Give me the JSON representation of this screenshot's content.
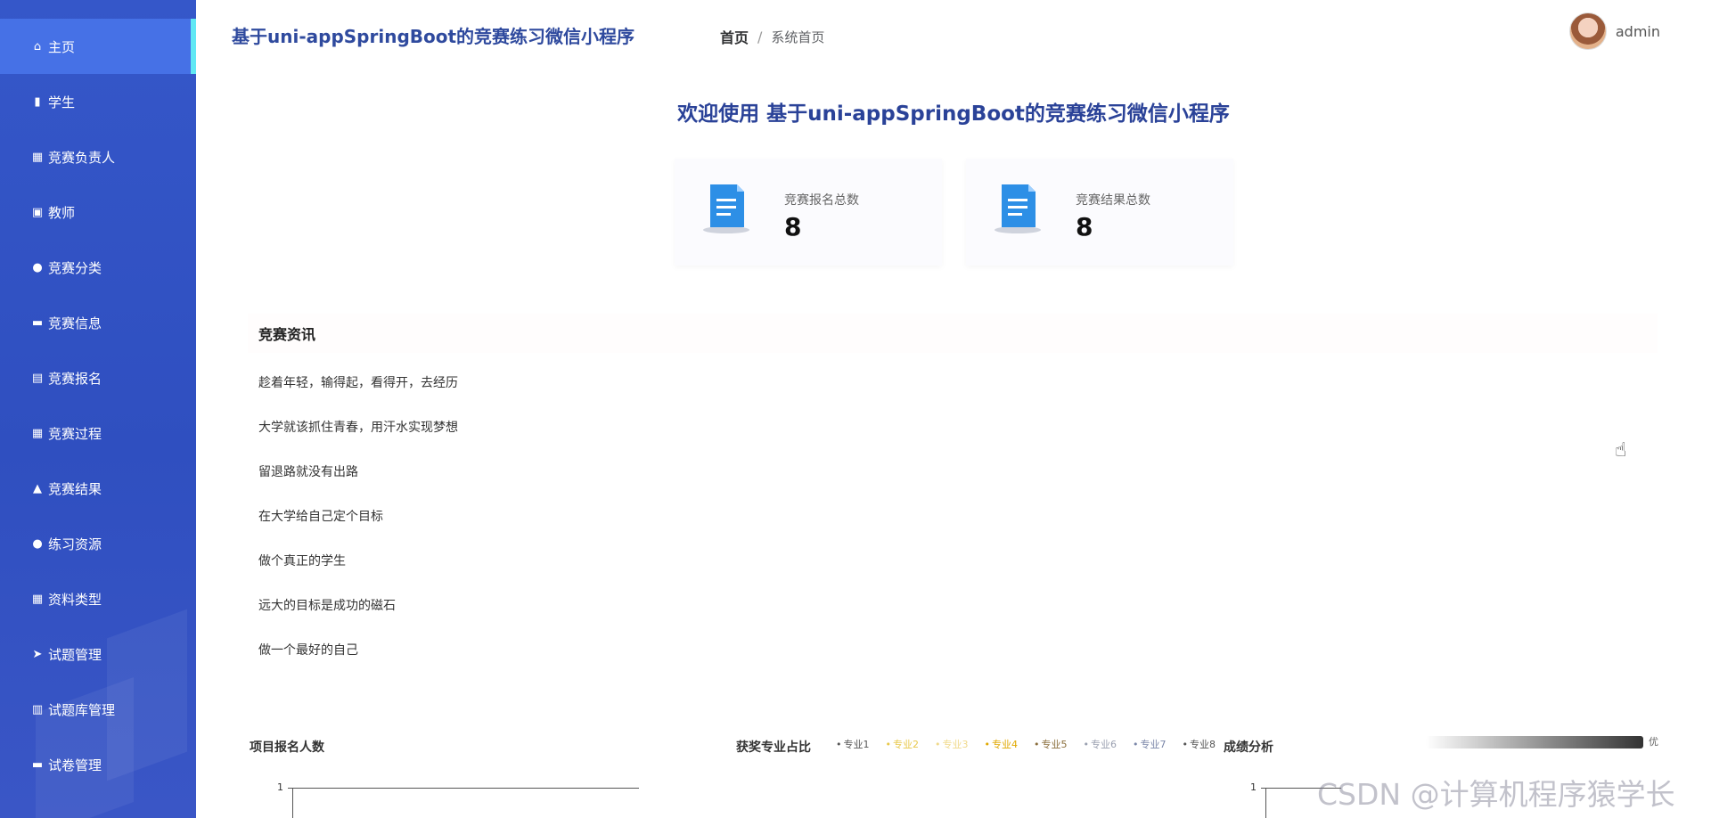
{
  "sidebar": {
    "items": [
      {
        "label": "主页",
        "icon": "home-icon",
        "glyph": "⌂",
        "active": true
      },
      {
        "label": "学生",
        "icon": "bar-chart-icon",
        "glyph": "▮"
      },
      {
        "label": "竞赛负责人",
        "icon": "grid-icon",
        "glyph": "▦"
      },
      {
        "label": "教师",
        "icon": "id-card-icon",
        "glyph": "▣"
      },
      {
        "label": "竞赛分类",
        "icon": "lightbulb-icon",
        "glyph": "●"
      },
      {
        "label": "竞赛信息",
        "icon": "briefcase-icon",
        "glyph": "▬"
      },
      {
        "label": "竞赛报名",
        "icon": "clipboard-icon",
        "glyph": "▤"
      },
      {
        "label": "竞赛过程",
        "icon": "apps-icon",
        "glyph": "▦"
      },
      {
        "label": "竞赛结果",
        "icon": "thumbs-up-icon",
        "glyph": "▲"
      },
      {
        "label": "练习资源",
        "icon": "user-icon",
        "glyph": "●"
      },
      {
        "label": "资料类型",
        "icon": "apps-icon",
        "glyph": "▦"
      },
      {
        "label": "试题管理",
        "icon": "send-icon",
        "glyph": "➤"
      },
      {
        "label": "试题库管理",
        "icon": "building-icon",
        "glyph": "▥"
      },
      {
        "label": "试卷管理",
        "icon": "folder-icon",
        "glyph": "▬"
      }
    ]
  },
  "header": {
    "app_title": "基于uni-appSpringBoot的竞赛练习微信小程序",
    "breadcrumb_home": "首页",
    "breadcrumb_sep": "/",
    "breadcrumb_current": "系统首页",
    "username": "admin"
  },
  "welcome": "欢迎使用 基于uni-appSpringBoot的竞赛练习微信小程序",
  "stats": [
    {
      "label": "竞赛报名总数",
      "value": "8",
      "icon": "document-icon"
    },
    {
      "label": "竞赛结果总数",
      "value": "8",
      "icon": "document-icon"
    }
  ],
  "news": {
    "title": "竞赛资讯",
    "items": [
      "趁着年轻，输得起，看得开，去经历",
      "大学就该抓住青春，用汗水实现梦想",
      "留退路就没有出路",
      "在大学给自己定个目标",
      "做个真正的学生",
      "远大的目标是成功的磁石",
      "做一个最好的自己"
    ]
  },
  "charts": {
    "signup_title": "项目报名人数",
    "major_title": "获奖专业占比",
    "score_title": "成绩分析",
    "legend": [
      {
        "name": "专业1",
        "color": "#555555"
      },
      {
        "name": "专业2",
        "color": "#e8c84a"
      },
      {
        "name": "专业3",
        "color": "#f0d98a"
      },
      {
        "name": "专业4",
        "color": "#e0a800"
      },
      {
        "name": "专业5",
        "color": "#8a6d3b"
      },
      {
        "name": "专业6",
        "color": "#9aa0b0"
      },
      {
        "name": "专业7",
        "color": "#7a86a8"
      },
      {
        "name": "专业8",
        "color": "#555555"
      }
    ],
    "gradient_label": "优",
    "axis_tick": "1"
  },
  "watermark": "CSDN @计算机程序猿学长"
}
